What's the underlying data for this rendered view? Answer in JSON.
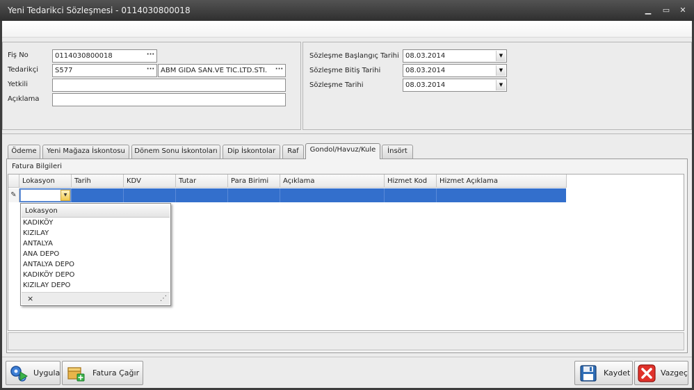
{
  "window": {
    "title": "Yeni Tedarikci Sözleşmesi - 0114030800018",
    "minimize_glyph": "▁",
    "maximize_glyph": "▭",
    "close_glyph": "✕"
  },
  "header_left": {
    "fis_no_label": "Fiş No",
    "fis_no_value": "0114030800018",
    "tedarikci_label": "Tedarikçi",
    "tedarikci_code": "S577",
    "tedarikci_name": "ABM GIDA SAN.VE TIC.LTD.STI.",
    "yetkili_label": "Yetkili",
    "yetkili_value": "",
    "aciklama_label": "Açıklama",
    "aciklama_value": "",
    "ellipsis": "···"
  },
  "header_right": {
    "baslangic_label": "Sözleşme Başlangıç Tarihi",
    "baslangic_value": "08.03.2014",
    "bitis_label": "Sözleşme Bitiş Tarihi",
    "bitis_value": "08.03.2014",
    "tarih_label": "Sözleşme Tarihi",
    "tarih_value": "08.03.2014",
    "dd_glyph": "▼"
  },
  "tabs": [
    {
      "label": "Ödeme"
    },
    {
      "label": "Yeni Mağaza İskontosu"
    },
    {
      "label": "Dönem Sonu İskontoları"
    },
    {
      "label": "Dip İskontolar"
    },
    {
      "label": "Raf"
    },
    {
      "label": "Gondol/Havuz/Kule"
    },
    {
      "label": "İnsört"
    }
  ],
  "active_tab": "Gondol/Havuz/Kule",
  "section_title": "Fatura Bilgileri",
  "grid": {
    "columns": [
      "Lokasyon",
      "Tarih",
      "KDV",
      "Tutar",
      "Para Birimi",
      "Açıklama",
      "Hizmet Kod",
      "Hizmet Açıklama"
    ],
    "edit_glyph": "✎",
    "cell_dd_glyph": "▼"
  },
  "lookup": {
    "header": "Lokasyon",
    "items": [
      "KADIKÖY",
      "KIZILAY",
      "ANTALYA",
      "ANA DEPO",
      "ANTALYA DEPO",
      "KADIKÖY DEPO",
      "KIZILAY DEPO"
    ],
    "clear_glyph": "×",
    "resize_glyph": "⋰"
  },
  "buttons": {
    "uygula": "Uygula",
    "fatura_cagir": "Fatura Çağır",
    "kaydet": "Kaydet",
    "vazgec": "Vazgeç"
  },
  "colors": {
    "selection": "#336fcc",
    "titlebar": "#3a3a3a"
  }
}
